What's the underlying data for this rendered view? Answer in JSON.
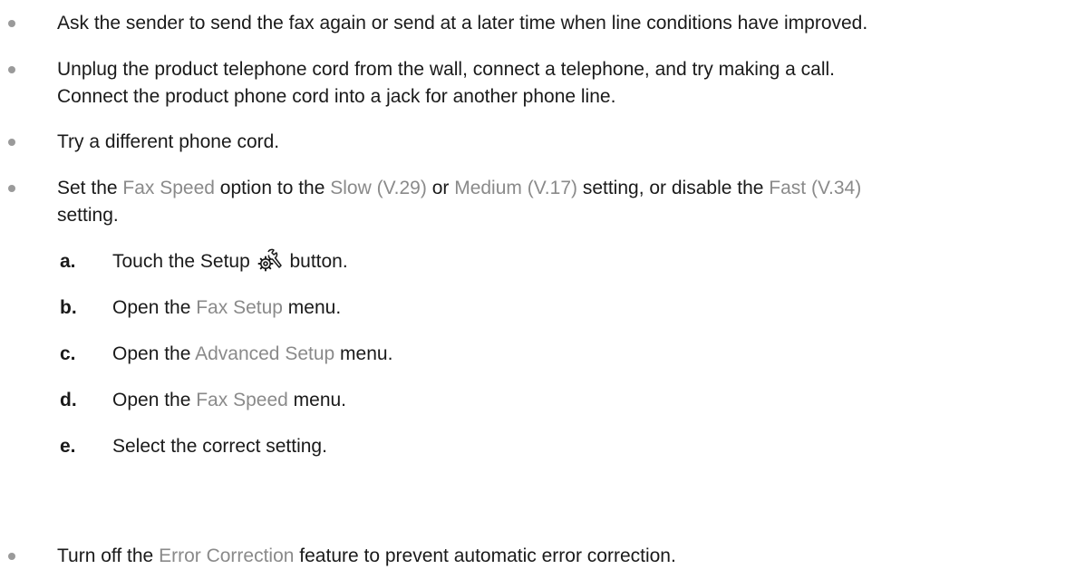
{
  "bullets": [
    {
      "text": "Ask the sender to send the fax again or send at a later time when line conditions have improved."
    },
    {
      "line1": "Unplug the product telephone cord from the wall, connect a telephone, and try making a call.",
      "line2": "Connect the product phone cord into a jack for another phone line."
    },
    {
      "text": "Try a different phone cord."
    },
    {
      "pre": "Set the ",
      "ui1": "Fax Speed",
      "mid1": " option to the ",
      "ui2": "Slow (V.29)",
      "mid2": " or ",
      "ui3": "Medium (V.17)",
      "mid3": " setting, or disable the ",
      "ui4": "Fast (V.34)",
      "post": "setting."
    },
    {
      "pre": "Turn off the ",
      "ui": "Error Correction",
      "post": " feature to prevent automatic error correction."
    }
  ],
  "steps": [
    {
      "letter": "a.",
      "pre": "Touch the Setup ",
      "icon": "setup-icon",
      "post": " button."
    },
    {
      "letter": "b.",
      "pre": "Open the ",
      "ui": "Fax Setup",
      "post": " menu."
    },
    {
      "letter": "c.",
      "pre": "Open the ",
      "ui": "Advanced Setup",
      "post": " menu."
    },
    {
      "letter": "d.",
      "pre": "Open the ",
      "ui": "Fax Speed",
      "post": " menu."
    },
    {
      "letter": "e.",
      "text": "Select the correct setting."
    }
  ],
  "colors": {
    "text": "#1a1a1a",
    "ui_term": "#8a8a8a",
    "bullet": "#9a9a9a"
  }
}
